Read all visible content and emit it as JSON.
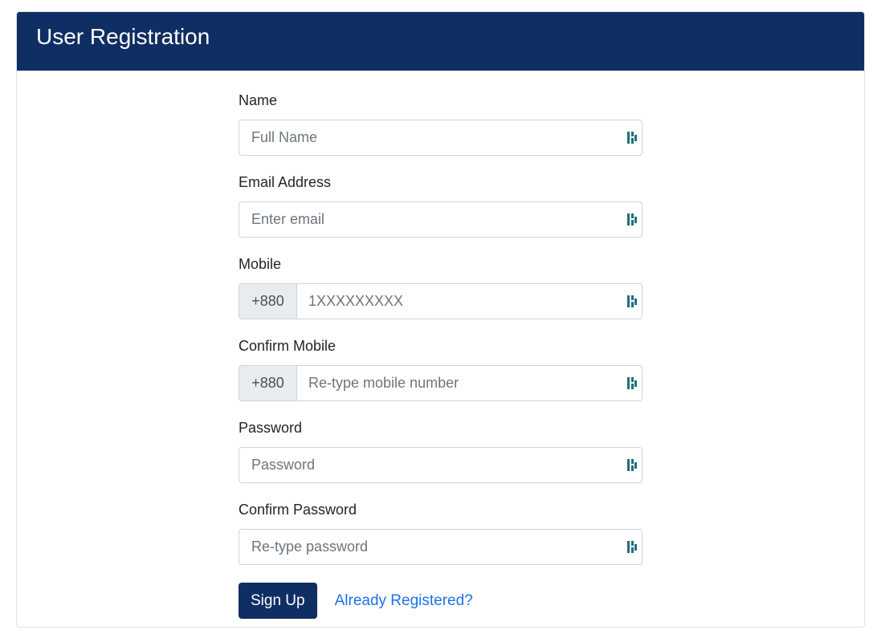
{
  "header": {
    "title": "User Registration"
  },
  "form": {
    "fields": [
      {
        "label": "Name",
        "placeholder": "Full Name"
      },
      {
        "label": "Email Address",
        "placeholder": "Enter email"
      },
      {
        "label": "Mobile",
        "prefix": "+880",
        "placeholder": "1XXXXXXXXX"
      },
      {
        "label": "Confirm Mobile",
        "prefix": "+880",
        "placeholder": "Re-type mobile number"
      },
      {
        "label": "Password",
        "placeholder": "Password"
      },
      {
        "label": "Confirm Password",
        "placeholder": "Re-type password"
      }
    ],
    "submit_label": "Sign Up",
    "login_link": "Already Registered?"
  },
  "icons": {
    "field_icon": "password-manager-icon"
  },
  "colors": {
    "header_bg": "#0f2e63",
    "button_bg": "#0f2e63",
    "link": "#1a73e8",
    "icon": "#1f6f7a"
  }
}
